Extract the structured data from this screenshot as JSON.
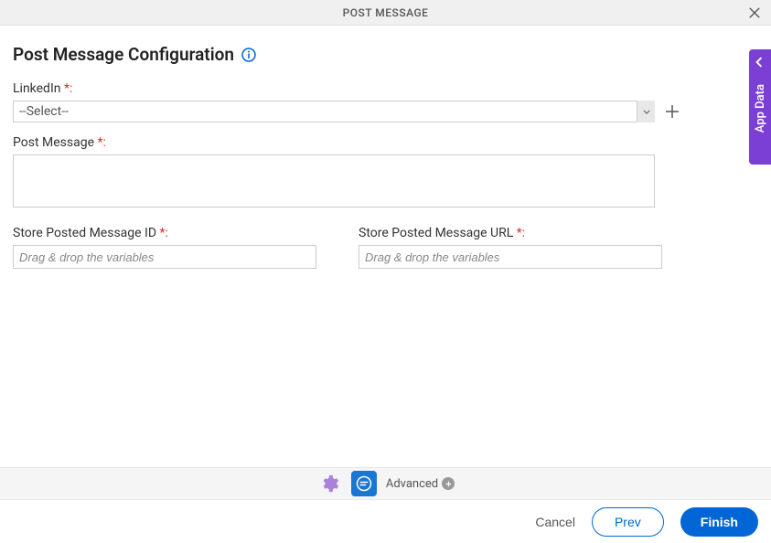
{
  "header": {
    "title": "POST MESSAGE"
  },
  "page": {
    "title": "Post Message Configuration"
  },
  "fields": {
    "linkedin": {
      "label": "LinkedIn ",
      "required_suffix": "*:",
      "select_value": "--Select--"
    },
    "post_message": {
      "label": "Post Message ",
      "required_suffix": "*:"
    },
    "store_id": {
      "label": "Store Posted Message ID ",
      "required_suffix": "*:",
      "placeholder": "Drag & drop the variables"
    },
    "store_url": {
      "label": "Store Posted Message URL ",
      "required_suffix": "*:",
      "placeholder": "Drag & drop the variables"
    }
  },
  "side_tab": {
    "label": "App Data"
  },
  "toolbar": {
    "advanced_label": "Advanced"
  },
  "footer": {
    "cancel": "Cancel",
    "prev": "Prev",
    "finish": "Finish"
  }
}
